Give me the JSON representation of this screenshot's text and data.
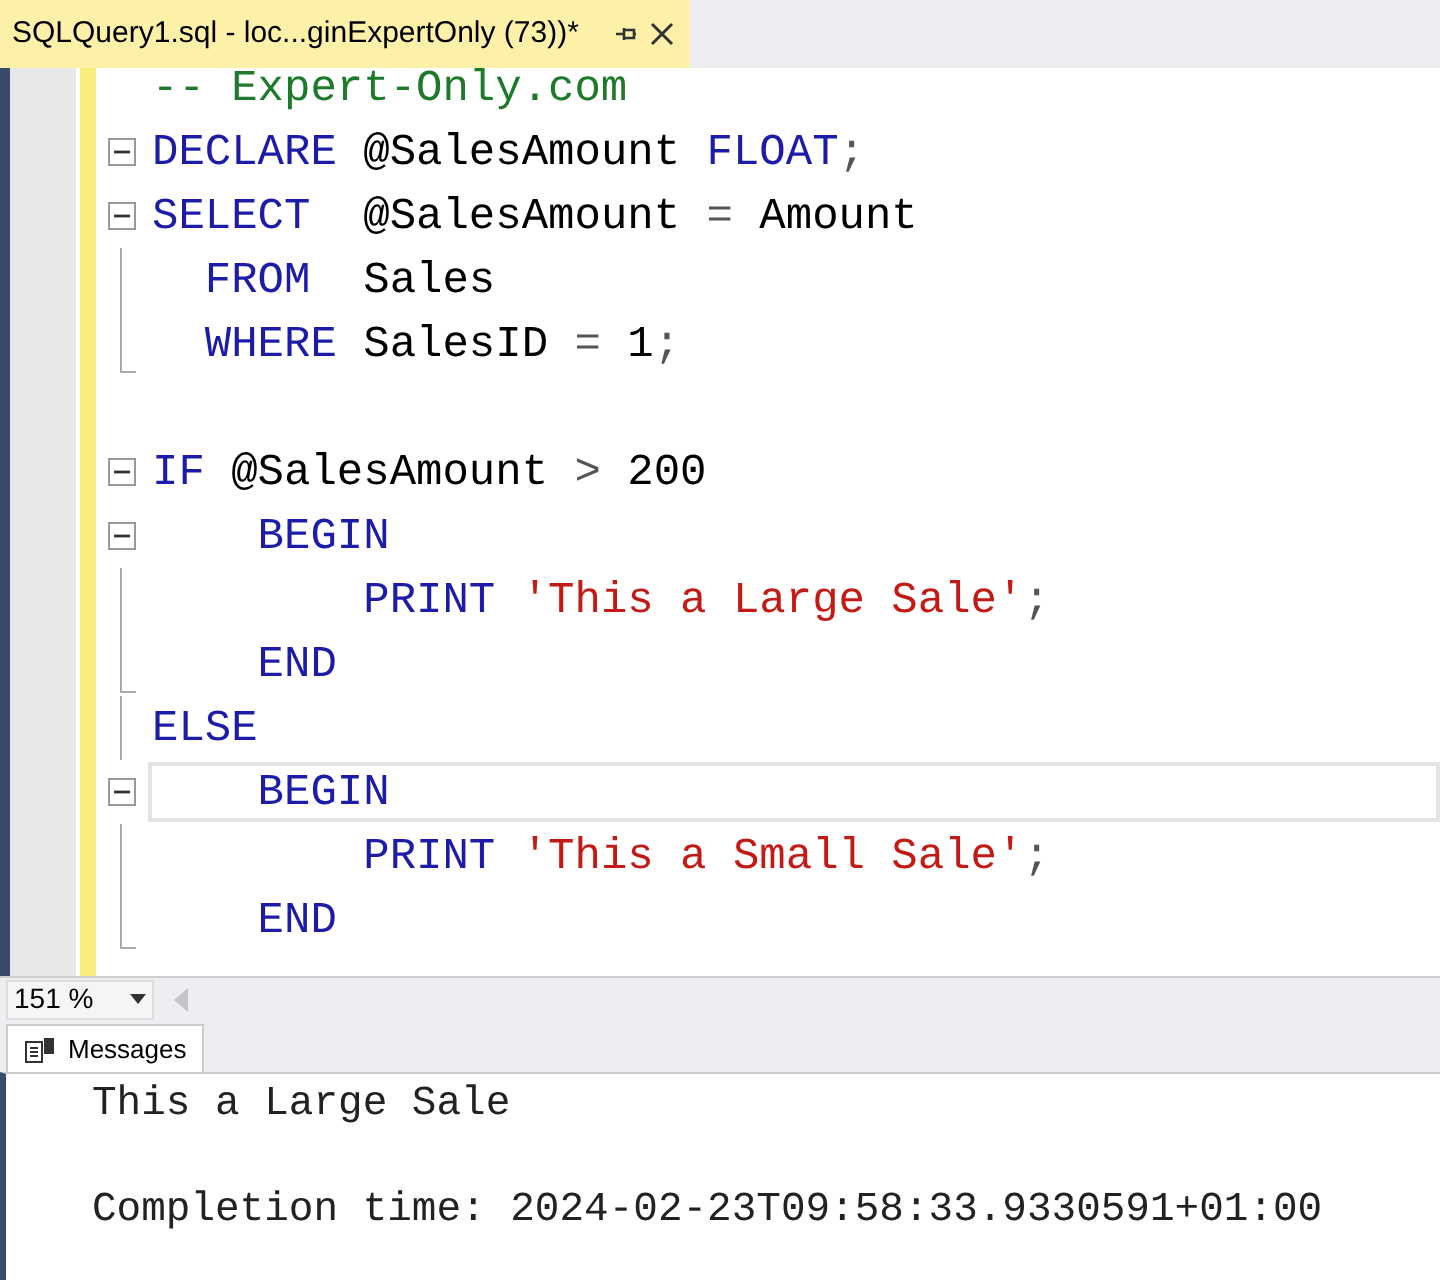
{
  "tab": {
    "title": "SQLQuery1.sql - loc...ginExpertOnly (73))*"
  },
  "editor": {
    "lines": [
      {
        "kind": "plain",
        "current": false,
        "tokens": [
          {
            "kind": "comment",
            "text": "-- Expert-Only.com"
          }
        ]
      },
      {
        "kind": "collapse",
        "current": false,
        "tokens": [
          {
            "kind": "keyword",
            "text": "DECLARE"
          },
          {
            "kind": "plain",
            "text": " @SalesAmount "
          },
          {
            "kind": "keyword",
            "text": "FLOAT"
          },
          {
            "kind": "operator",
            "text": ";"
          }
        ]
      },
      {
        "kind": "collapse",
        "current": false,
        "tokens": [
          {
            "kind": "keyword",
            "text": "SELECT"
          },
          {
            "kind": "plain",
            "text": "  @SalesAmount "
          },
          {
            "kind": "operator",
            "text": "="
          },
          {
            "kind": "plain",
            "text": " Amount"
          }
        ]
      },
      {
        "kind": "line",
        "current": false,
        "tokens": [
          {
            "kind": "keyword",
            "text": "  FROM"
          },
          {
            "kind": "plain",
            "text": "  Sales"
          }
        ]
      },
      {
        "kind": "end",
        "current": false,
        "tokens": [
          {
            "kind": "keyword",
            "text": "  WHERE"
          },
          {
            "kind": "plain",
            "text": " SalesID "
          },
          {
            "kind": "operator",
            "text": "="
          },
          {
            "kind": "plain",
            "text": " 1"
          },
          {
            "kind": "operator",
            "text": ";"
          }
        ]
      },
      {
        "kind": "blank",
        "current": false
      },
      {
        "kind": "collapse",
        "current": false,
        "tokens": [
          {
            "kind": "keyword",
            "text": "IF"
          },
          {
            "kind": "plain",
            "text": " @SalesAmount "
          },
          {
            "kind": "operator",
            "text": ">"
          },
          {
            "kind": "plain",
            "text": " 200"
          }
        ]
      },
      {
        "kind": "collapse",
        "current": false,
        "tokens": [
          {
            "kind": "keyword",
            "text": "    BEGIN"
          }
        ]
      },
      {
        "kind": "line",
        "current": false,
        "tokens": [
          {
            "kind": "keyword",
            "text": "        PRINT "
          },
          {
            "kind": "string",
            "text": "'This a Large Sale'"
          },
          {
            "kind": "operator",
            "text": ";"
          }
        ]
      },
      {
        "kind": "end",
        "current": false,
        "tokens": [
          {
            "kind": "keyword",
            "text": "    END"
          }
        ]
      },
      {
        "kind": "line",
        "current": false,
        "tokens": [
          {
            "kind": "keyword",
            "text": "ELSE"
          }
        ]
      },
      {
        "kind": "collapse",
        "current": true,
        "tokens": [
          {
            "kind": "keyword",
            "text": "    BEGIN"
          }
        ]
      },
      {
        "kind": "line",
        "current": false,
        "tokens": [
          {
            "kind": "keyword",
            "text": "        PRINT "
          },
          {
            "kind": "string",
            "text": "'This a Small Sale'"
          },
          {
            "kind": "operator",
            "text": ";"
          }
        ]
      },
      {
        "kind": "end",
        "current": false,
        "tokens": [
          {
            "kind": "keyword",
            "text": "    END"
          }
        ]
      }
    ]
  },
  "zoom": {
    "value": "151 %"
  },
  "results": {
    "tab": {
      "label": "Messages"
    },
    "lines": [
      "This a Large Sale",
      "Completion time: 2024-02-23T09:58:33.9330591+01:00"
    ]
  }
}
